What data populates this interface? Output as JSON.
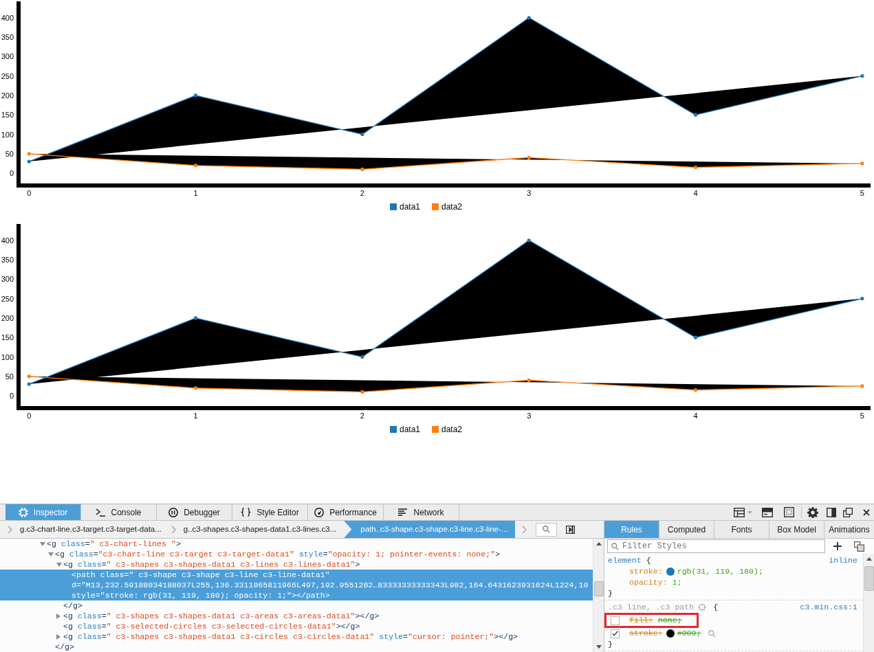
{
  "charts": [
    {
      "chart_data": {
        "type": "line",
        "x": [
          0,
          1,
          2,
          3,
          4,
          5
        ],
        "series": [
          {
            "name": "data1",
            "color": "#1f77b4",
            "values": [
              30,
              200,
              100,
              400,
              150,
              250
            ]
          },
          {
            "name": "data2",
            "color": "#ff7f0e",
            "values": [
              50,
              20,
              10,
              40,
              15,
              25
            ]
          }
        ],
        "xlim": [
          -0.075,
          5.05
        ],
        "ylim": [
          -37,
          442
        ],
        "xticks": [
          0,
          1,
          2,
          3,
          4,
          5
        ],
        "yticks": [
          0,
          50,
          100,
          150,
          200,
          250,
          300,
          350,
          400
        ],
        "legend": "bottom"
      }
    },
    {
      "chart_data": {
        "type": "line",
        "x": [
          0,
          1,
          2,
          3,
          4,
          5
        ],
        "series": [
          {
            "name": "data1",
            "color": "#1f77b4",
            "values": [
              30,
              200,
              100,
              400,
              150,
              250
            ]
          },
          {
            "name": "data2",
            "color": "#ff7f0e",
            "values": [
              50,
              20,
              10,
              40,
              15,
              25
            ]
          }
        ],
        "xlim": [
          -0.075,
          5.05
        ],
        "ylim": [
          -37,
          442
        ],
        "xticks": [
          0,
          1,
          2,
          3,
          4,
          5
        ],
        "yticks": [
          0,
          50,
          100,
          150,
          200,
          250,
          300,
          350,
          400
        ],
        "legend": "bottom"
      }
    }
  ],
  "devtools": {
    "tabs": [
      {
        "label": "Inspector",
        "selected": true
      },
      {
        "label": "Console",
        "selected": false
      },
      {
        "label": "Debugger",
        "selected": false
      },
      {
        "label": "Style Editor",
        "selected": false
      },
      {
        "label": "Performance",
        "selected": false
      },
      {
        "label": "Network",
        "selected": false
      }
    ],
    "breadcrumbs": [
      {
        "label": "g.c3-chart-line.c3-target.c3-target-data...",
        "selected": false
      },
      {
        "label": "g..c3-shapes.c3-shapes-data1.c3-lines.c3...",
        "selected": false
      },
      {
        "label": "path..c3-shape.c3-shape.c3-line.c3-line-...",
        "selected": true
      }
    ],
    "markup": [
      {
        "text": "<g class=\" c3-chart-lines \">",
        "expanded": true,
        "selected": false,
        "children": [
          {
            "text": "<g class=\"c3-chart-line c3-target c3-target-data1\" style=\"opacity: 1; pointer-events: none;\">",
            "expanded": true,
            "selected": false,
            "children": [
              {
                "text": "<g class=\" c3-shapes c3-shapes-data1 c3-lines c3-lines-data1\">",
                "expanded": true,
                "selected": false,
                "children": [
                  {
                    "lines": [
                      "<path class=\" c3-shape c3-shape c3-line c3-line-data1\"",
                      "d=\"M13,232.59188034188037L255,136.3311965811966L497,192.9551282…83333333333343L982,164.6431623931624L1224,10",
                      "style=\"stroke: rgb(31, 119, 180); opacity: 1;\"></path>"
                    ],
                    "selected": true
                  }
                ],
                "close": "</g>"
              },
              {
                "text": "<g class=\" c3-shapes c3-shapes-data1 c3-areas c3-areas-data1\"></g>",
                "expanded": false,
                "selected": false
              },
              {
                "text": "<g class=\" c3-selected-circles c3-selected-circles-data1\"></g>",
                "selected": false
              },
              {
                "text": "<g class=\" c3-shapes c3-shapes-data1 c3-circles c3-circles-data1\" style=\"cursor: pointer;\"></g>",
                "expanded": false,
                "selected": false
              }
            ],
            "close": "</g>"
          }
        ]
      }
    ],
    "sidebar_tabs": [
      {
        "label": "Rules",
        "selected": true
      },
      {
        "label": "Computed",
        "selected": false
      },
      {
        "label": "Fonts",
        "selected": false
      },
      {
        "label": "Box Model",
        "selected": false
      },
      {
        "label": "Animations",
        "selected": false
      }
    ],
    "filter": {
      "placeholder": "Filter Styles"
    },
    "rules": [
      {
        "kind": "element",
        "selector": "element",
        "open": "{",
        "source": "inline",
        "declarations": [
          {
            "property": "stroke:",
            "color": "#1f77b4",
            "value": "rgb(31, 119, 180);",
            "overridden": false,
            "annotated": false
          },
          {
            "property": "opacity:",
            "value": "1;",
            "overridden": false,
            "annotated": false
          }
        ],
        "close": "}"
      },
      {
        "kind": "stylesheet",
        "selector": ".c3 line, .c3 path",
        "open": "{",
        "source": "c3.min.css:1",
        "declarations": [
          {
            "property": "fill:",
            "value": "none;",
            "checked": false,
            "overridden": true,
            "annotated": true
          },
          {
            "property": "stroke:",
            "color": "#000000",
            "value": "#000;",
            "checked": true,
            "overridden": true,
            "annotated": false
          }
        ],
        "close": "}"
      }
    ]
  }
}
